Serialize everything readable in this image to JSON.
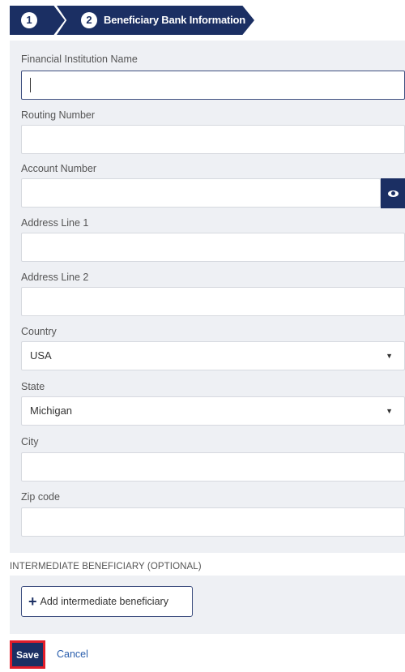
{
  "steps": {
    "step1_number": "1",
    "step2_number": "2",
    "step2_title": "Beneficiary Bank Information"
  },
  "form": {
    "financial_institution_label": "Financial Institution Name",
    "financial_institution_value": "",
    "routing_number_label": "Routing Number",
    "routing_number_value": "",
    "account_number_label": "Account Number",
    "account_number_value": "",
    "address_line1_label": "Address Line 1",
    "address_line1_value": "",
    "address_line2_label": "Address Line 2",
    "address_line2_value": "",
    "country_label": "Country",
    "country_value": "USA",
    "state_label": "State",
    "state_value": "Michigan",
    "city_label": "City",
    "city_value": "",
    "zip_label": "Zip code",
    "zip_value": ""
  },
  "intermediate": {
    "heading": "INTERMEDIATE BENEFICIARY (OPTIONAL)",
    "add_button_label": "Add intermediate beneficiary"
  },
  "footer": {
    "save_label": "Save",
    "cancel_label": "Cancel"
  },
  "icons": {
    "eye": "eye-icon",
    "caret": "caret-down-icon",
    "plus": "plus-icon"
  },
  "colors": {
    "navy": "#1b2f63",
    "panel_bg": "#eef0f4",
    "save_outline": "#e11d2a",
    "link": "#2b5fad"
  }
}
